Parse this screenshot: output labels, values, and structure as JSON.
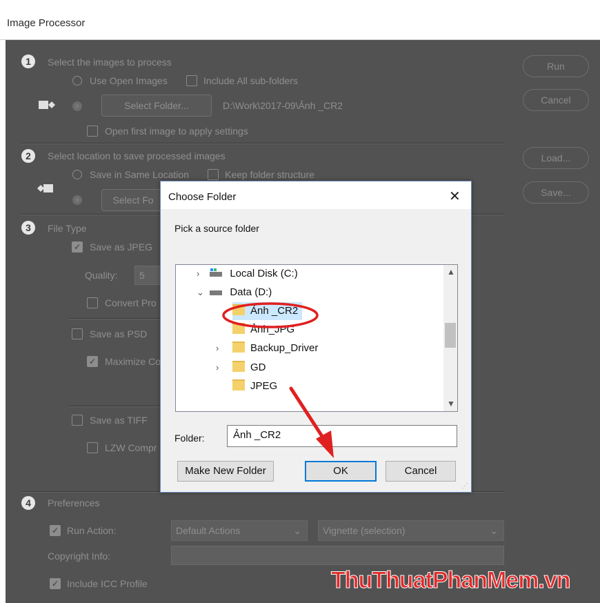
{
  "window": {
    "title": "Image Processor"
  },
  "section1": {
    "number": "1",
    "heading": "Select the images to process",
    "use_open_images": "Use Open Images",
    "include_subfolders": "Include All sub-folders",
    "select_folder_btn": "Select Folder...",
    "folder_path": "D:\\Work\\2017-09\\Ảnh _CR2",
    "open_first_image": "Open first image to apply settings"
  },
  "section2": {
    "number": "2",
    "heading": "Select location to save processed images",
    "save_same_location": "Save in Same Location",
    "keep_folder_structure": "Keep folder structure",
    "select_folder_btn": "Select Fo"
  },
  "section3": {
    "number": "3",
    "heading": "File Type",
    "save_jpeg": "Save as JPEG",
    "quality_label": "Quality:",
    "quality_value": "5",
    "convert_profile": "Convert Pro",
    "save_psd": "Save as PSD",
    "maximize": "Maximize Co",
    "save_tiff": "Save as TIFF",
    "lzw": "LZW Compr"
  },
  "section4": {
    "number": "4",
    "heading": "Preferences",
    "run_action": "Run Action:",
    "action_set": "Default Actions",
    "action": "Vignette (selection)",
    "copyright": "Copyright Info:",
    "icc": "Include ICC Profile"
  },
  "side_buttons": {
    "run": "Run",
    "cancel": "Cancel",
    "load": "Load...",
    "save": "Save..."
  },
  "dialog": {
    "title": "Choose Folder",
    "close": "✕",
    "prompt": "Pick a source folder",
    "tree": [
      {
        "label": "Local Disk (C:)",
        "expander": "›"
      },
      {
        "label": "Data (D:)",
        "expander": "⌄"
      },
      {
        "label": "Ảnh _CR2",
        "expander": ""
      },
      {
        "label": "Ảnh_JPG",
        "expander": ""
      },
      {
        "label": "Backup_Driver",
        "expander": "›"
      },
      {
        "label": "GD",
        "expander": "›"
      },
      {
        "label": "JPEG",
        "expander": ""
      }
    ],
    "folder_label": "Folder:",
    "folder_value": "Ảnh _CR2",
    "make_new_folder": "Make New Folder",
    "ok": "OK",
    "cancel": "Cancel"
  },
  "watermark": "ThuThuatPhanMem.vn",
  "colors": {
    "annotation_red": "#e02020",
    "selection_blue": "#cce8ff",
    "ok_border": "#0078d7"
  }
}
